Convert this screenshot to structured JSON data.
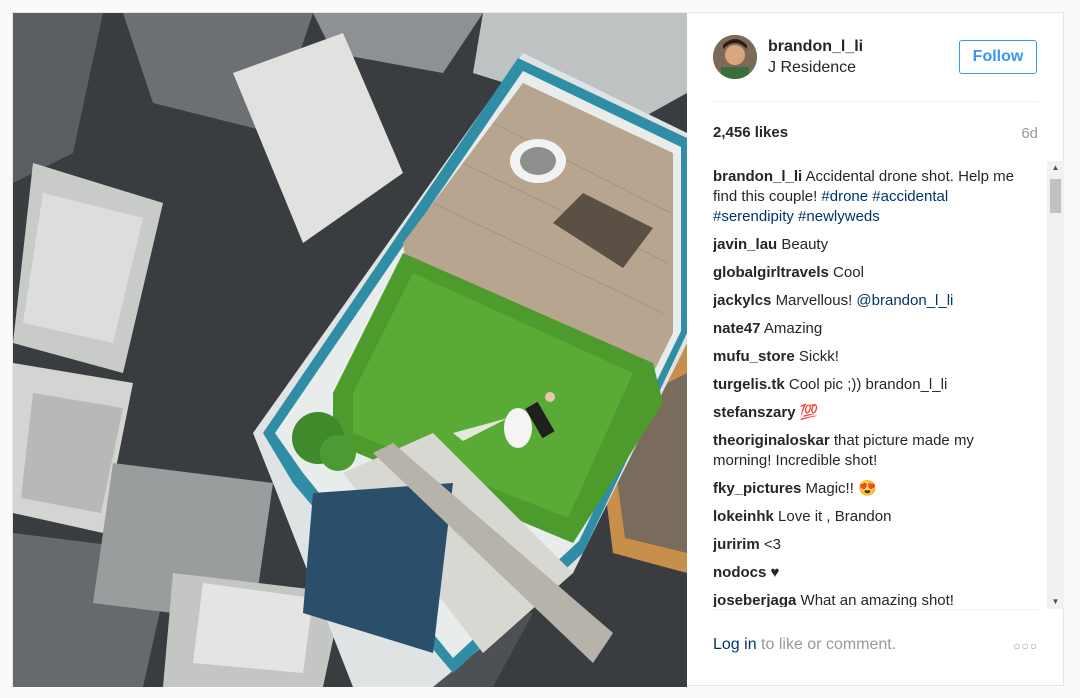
{
  "post": {
    "image_alt": "Aerial drone shot of a couple lying on rooftop lawn",
    "header": {
      "username": "brandon_l_li",
      "location": "J Residence",
      "follow_label": "Follow"
    },
    "likes": "2,456 likes",
    "age": "6d",
    "comments": [
      {
        "user": "brandon_l_li",
        "text": "Accidental drone shot. Help me find this couple! ",
        "tags": "#drone #accidental #serendipity #newlyweds"
      },
      {
        "user": "javin_lau",
        "text": "Beauty"
      },
      {
        "user": "globalgirltravels",
        "text": "Cool"
      },
      {
        "user": "jackylcs",
        "text": "Marvellous! ",
        "tags": "@brandon_l_li"
      },
      {
        "user": "nate47",
        "text": "Amazing"
      },
      {
        "user": "mufu_store",
        "text": "Sickk!"
      },
      {
        "user": "turgelis.tk",
        "text": "Cool pic ;)) brandon_l_li"
      },
      {
        "user": "stefanszary",
        "text": "💯"
      },
      {
        "user": "theoriginaloskar",
        "text": "that picture made my morning! Incredible shot!"
      },
      {
        "user": "fky_pictures",
        "text": "Magic!! 😍"
      },
      {
        "user": "lokeinhk",
        "text": "Love it , Brandon"
      },
      {
        "user": "juririm",
        "text": "<3"
      },
      {
        "user": "nodocs",
        "text": "♥"
      },
      {
        "user": "joseberjaga",
        "text": "What an amazing shot!"
      }
    ],
    "footer": {
      "login_label": "Log in",
      "rest_text": " to like or comment.",
      "more_label": "○○○"
    },
    "colors": {
      "accent": "#3897f0",
      "link": "#003569",
      "muted": "#999999"
    },
    "icons": [
      "avatar-photo",
      "more-options-icon",
      "scroll-up-arrow",
      "scroll-down-arrow"
    ]
  }
}
